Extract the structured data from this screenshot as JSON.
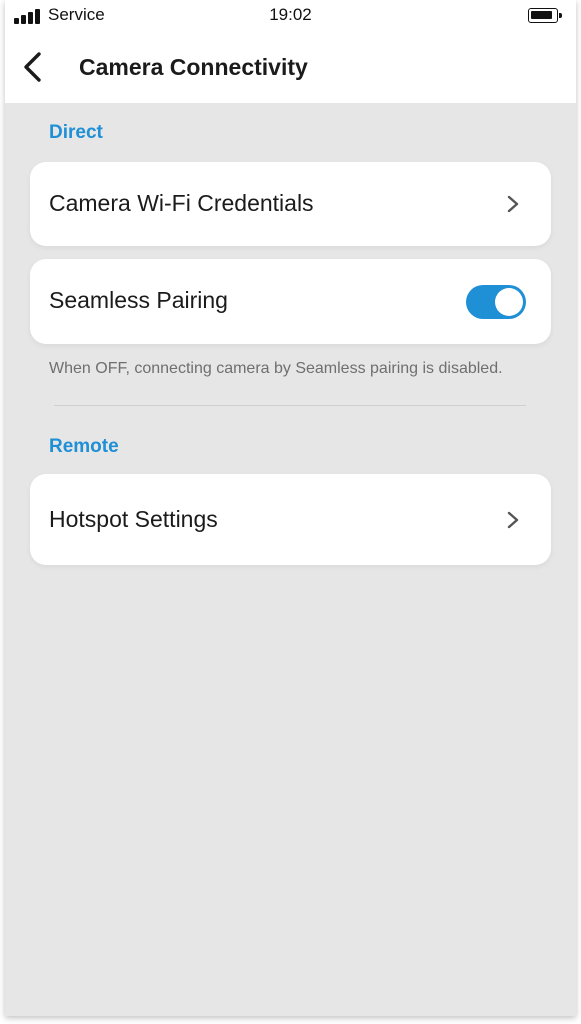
{
  "status_bar": {
    "carrier": "Service",
    "time": "19:02"
  },
  "header": {
    "title": "Camera Connectivity"
  },
  "sections": {
    "direct": {
      "title": "Direct",
      "wifi_credentials_label": "Camera Wi-Fi Credentials",
      "seamless_pairing_label": "Seamless Pairing",
      "seamless_pairing_enabled": true,
      "seamless_pairing_hint": "When OFF, connecting camera by Seamless pairing is disabled."
    },
    "remote": {
      "title": "Remote",
      "hotspot_label": "Hotspot Settings"
    }
  },
  "colors": {
    "accent": "#1f8fd6",
    "background": "#e6e6e6",
    "card": "#ffffff"
  },
  "icons": [
    "signal-icon",
    "battery-icon",
    "back-arrow-icon",
    "chevron-right-icon"
  ]
}
